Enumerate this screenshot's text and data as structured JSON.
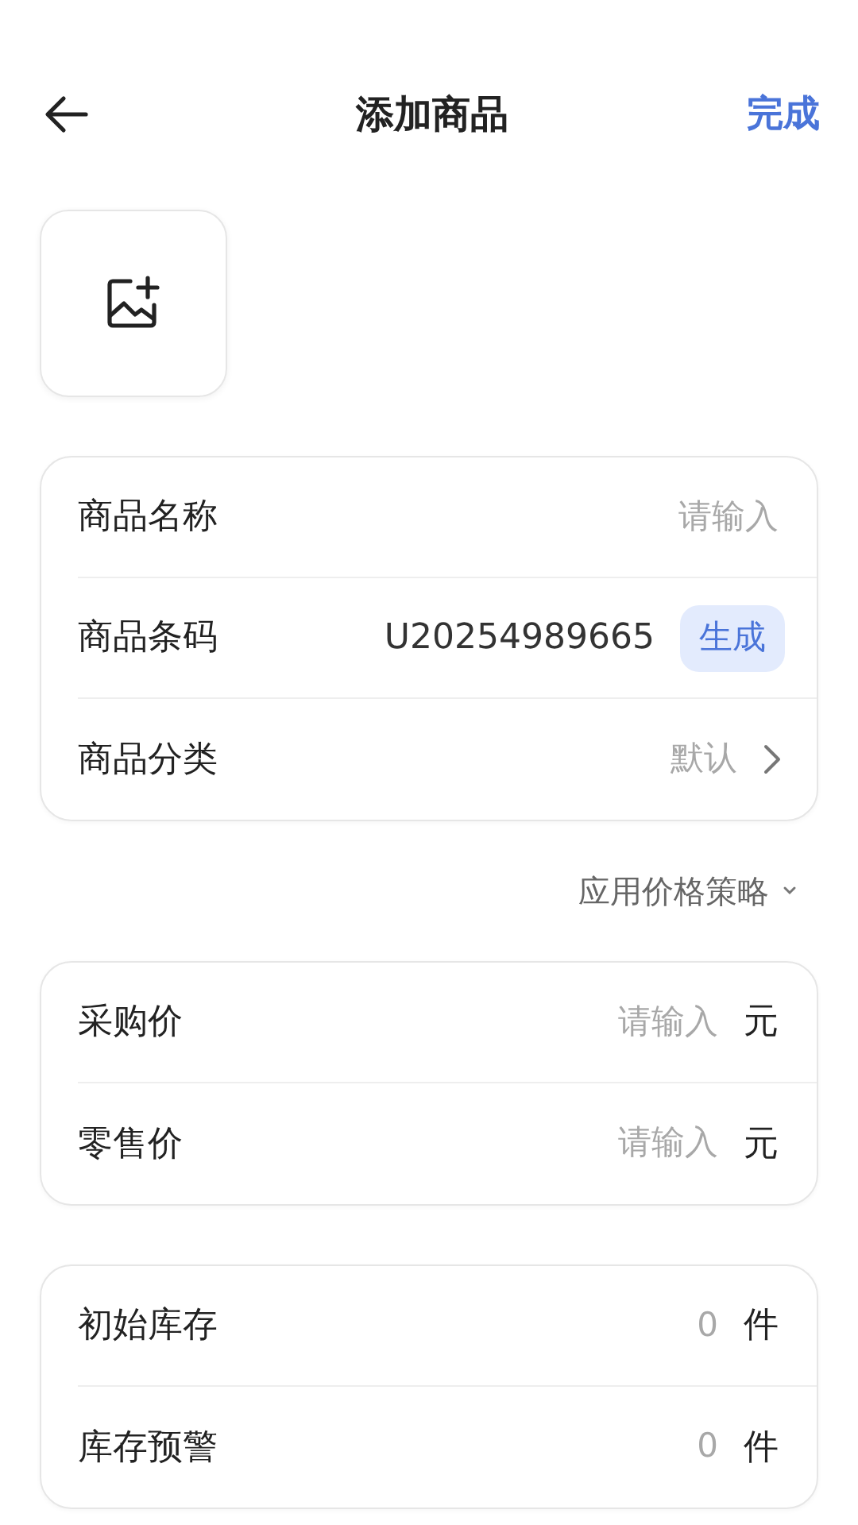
{
  "header": {
    "title": "添加商品",
    "action": "完成"
  },
  "basic_info": [
    {
      "kind": "input",
      "label": "商品名称",
      "placeholder": "请输入"
    },
    {
      "kind": "code",
      "label": "商品条码",
      "value": "U20254989665",
      "button": "生成"
    },
    {
      "kind": "select",
      "label": "商品分类",
      "value": "默认"
    }
  ],
  "price_strategy": {
    "label": "应用价格策略"
  },
  "prices": [
    {
      "kind": "input",
      "label": "采购价",
      "placeholder": "请输入",
      "unit": "元"
    },
    {
      "kind": "input",
      "label": "零售价",
      "placeholder": "请输入",
      "unit": "元"
    }
  ],
  "stock": [
    {
      "kind": "value",
      "label": "初始库存",
      "value": "0",
      "unit": "件"
    },
    {
      "kind": "value",
      "label": "库存预警",
      "value": "0",
      "unit": "件"
    }
  ]
}
